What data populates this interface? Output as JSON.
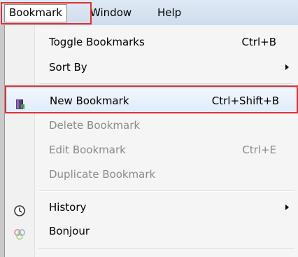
{
  "menubar": {
    "items": [
      {
        "label": "Bookmark",
        "active": true
      },
      {
        "label": "Window"
      },
      {
        "label": "Help"
      }
    ]
  },
  "menu": {
    "items": [
      {
        "label": "Toggle Bookmarks",
        "shortcut": "Ctrl+B"
      },
      {
        "label": "Sort By",
        "submenu": true
      },
      {
        "label": "New Bookmark",
        "shortcut": "Ctrl+Shift+B",
        "icon": "bookmark-book-icon",
        "highlighted": true
      },
      {
        "label": "Delete Bookmark",
        "disabled": true
      },
      {
        "label": "Edit Bookmark",
        "shortcut": "Ctrl+E",
        "disabled": true
      },
      {
        "label": "Duplicate Bookmark",
        "disabled": true
      },
      {
        "label": "History",
        "submenu": true,
        "icon": "clock-icon"
      },
      {
        "label": "Bonjour",
        "icon": "bonjour-icon"
      }
    ]
  },
  "colors": {
    "highlight_outline": "#e0302f",
    "hover_border": "#9ebfe6",
    "disabled_text": "#8a8a8a"
  }
}
